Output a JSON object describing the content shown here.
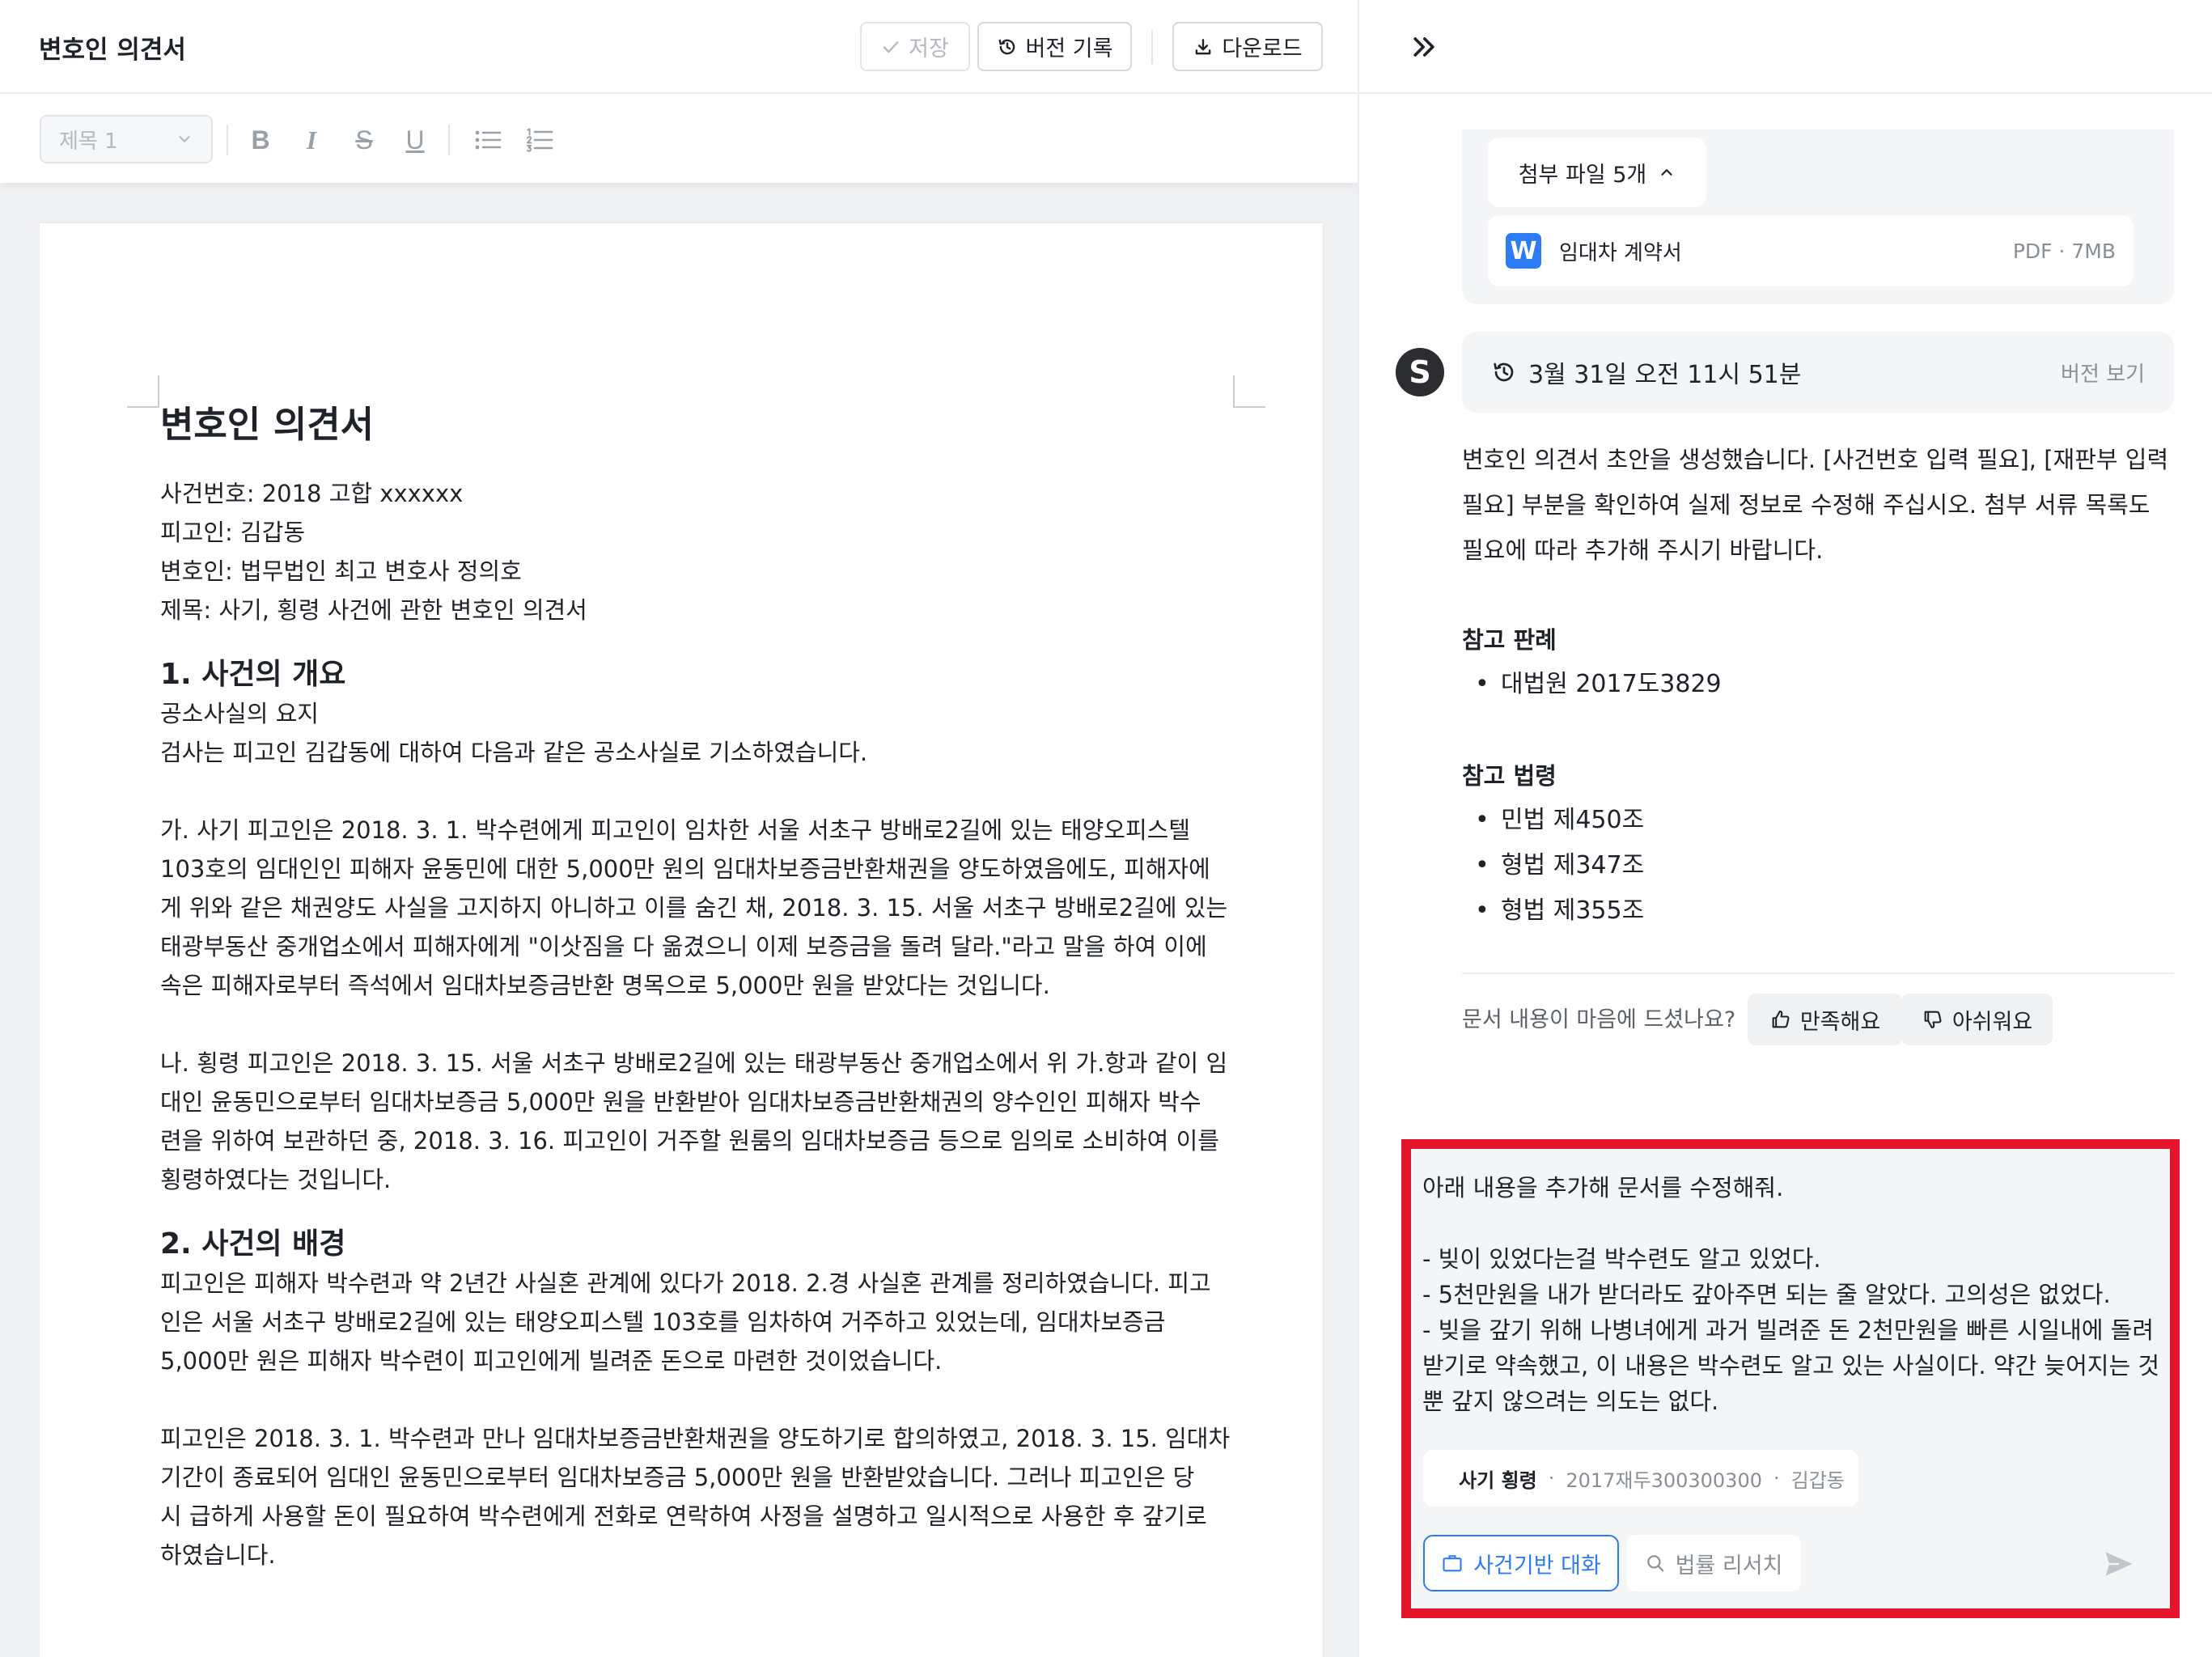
{
  "editor": {
    "title": "변호인 의견서",
    "toolbar": {
      "save_label": "저장",
      "history_label": "버전 기록",
      "download_label": "다운로드"
    },
    "format": {
      "style_value": "제목 1",
      "bold": "B",
      "italic": "I",
      "strike": "S",
      "underline": "U"
    },
    "document": {
      "heading": "변호인 의견서",
      "meta": [
        "사건번호: 2018 고합 xxxxxx",
        "피고인: 김갑동",
        "변호인: 법무법인 최고 변호사 정의호",
        "제목: 사기, 횡령 사건에 관한 변호인 의견서"
      ],
      "section1": {
        "title": "1. 사건의 개요",
        "lines": [
          "공소사실의 요지",
          "검사는 피고인 김갑동에 대하여 다음과 같은 공소사실로 기소하였습니다."
        ],
        "para_ga": [
          "가. 사기 피고인은 2018. 3. 1. 박수련에게 피고인이 임차한 서울 서초구 방배로2길에 있는 태양오피스텔",
          "103호의 임대인인 피해자 윤동민에 대한 5,000만 원의 임대차보증금반환채권을 양도하였음에도, 피해자에",
          "게 위와 같은 채권양도 사실을 고지하지 아니하고 이를 숨긴 채, 2018. 3. 15. 서울 서초구 방배로2길에 있는",
          "태광부동산 중개업소에서 피해자에게 \"이삿짐을 다 옮겼으니 이제 보증금을 돌려 달라.\"라고 말을 하여 이에",
          "속은 피해자로부터 즉석에서 임대차보증금반환 명목으로 5,000만 원을 받았다는 것입니다."
        ],
        "para_na": [
          "나. 횡령 피고인은 2018. 3. 15. 서울 서초구 방배로2길에 있는 태광부동산 중개업소에서 위 가.항과 같이 임",
          "대인 윤동민으로부터 임대차보증금 5,000만 원을 반환받아 임대차보증금반환채권의 양수인인 피해자 박수",
          "련을 위하여 보관하던 중, 2018. 3. 16. 피고인이 거주할 원룸의 임대차보증금 등으로 임의로 소비하여 이를",
          "횡령하였다는 것입니다."
        ]
      },
      "section2": {
        "title": "2. 사건의 배경",
        "para1": [
          "피고인은 피해자 박수련과 약 2년간 사실혼 관계에 있다가 2018. 2.경 사실혼 관계를 정리하였습니다. 피고",
          "인은 서울 서초구 방배로2길에 있는 태양오피스텔 103호를 임차하여 거주하고 있었는데, 임대차보증금",
          "5,000만 원은 피해자 박수련이 피고인에게 빌려준 돈으로 마련한 것이었습니다."
        ],
        "para2": [
          "피고인은 2018. 3. 1. 박수련과 만나 임대차보증금반환채권을 양도하기로 합의하였고, 2018. 3. 15. 임대차",
          "기간이 종료되어 임대인 윤동민으로부터 임대차보증금 5,000만 원을 반환받았습니다. 그러나 피고인은 당",
          "시 급하게 사용할 돈이 필요하여 박수련에게 전화로 연락하여 사정을 설명하고 일시적으로 사용한 후 갚기로",
          "하였습니다."
        ]
      }
    }
  },
  "panel": {
    "attachments": {
      "toggle_label": "첨부 파일 5개",
      "file_icon_letter": "W",
      "file_name": "임대차 계약서",
      "file_meta": "PDF · 7MB"
    },
    "message": {
      "avatar_letter": "S",
      "version_time": "3월 31일 오전 11시 51분",
      "version_link": "버전 보기",
      "body": "변호인 의견서 초안을 생성했습니다. [사건번호 입력 필요], [재판부 입력 필요] 부분을 확인하여 실제 정보로 수정해 주십시오. 첨부 서류 목록도 필요에 따라 추가해 주시기 바랍니다.",
      "ref_cases_title": "참고 판례",
      "ref_cases": [
        "대법원 2017도3829"
      ],
      "ref_laws_title": "참고 법령",
      "ref_laws": [
        "민법 제450조",
        "형법 제347조",
        "형법 제355조"
      ],
      "bullet": "•"
    },
    "feedback": {
      "question": "문서 내용이 마음에 드셨나요?",
      "good_label": "만족해요",
      "bad_label": "아쉬워요"
    },
    "input": {
      "text": "아래 내용을 추가해 문서를 수정해줘.\n\n- 빚이 있었다는걸 박수련도 알고 있었다.\n- 5천만원을 내가 받더라도 갚아주면 되는 줄 알았다. 고의성은 없었다.\n- 빚을 갚기 위해 나병녀에게 과거 빌려준 돈 2천만원을 빠른 시일내에 돌려받기로 약속했고, 이 내용은 박수련도 알고 있는 사실이다. 약간 늦어지는 것 뿐 갚지 않으려는 의도는 없다.",
      "case_chip": {
        "name": "사기 횡령",
        "number": "2017재두300300300",
        "party": "김갑동",
        "sep": "·"
      },
      "mode_case_label": "사건기반 대화",
      "mode_research_label": "법률 리서치"
    },
    "colors": {
      "accent": "#2e7bf6",
      "highlight_border": "#e4142d"
    }
  }
}
